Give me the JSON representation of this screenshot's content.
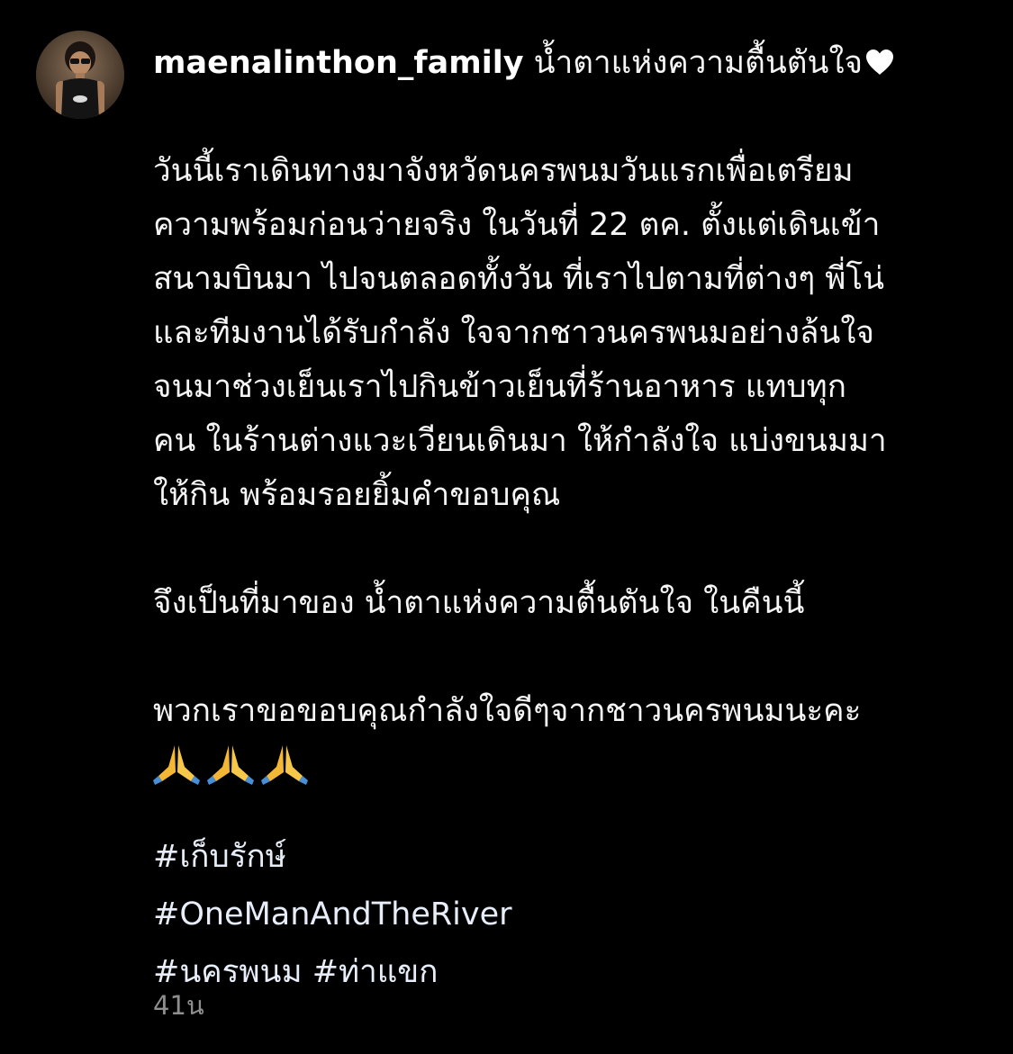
{
  "post": {
    "username": "maenalinthon_family",
    "title_text": "น้ำตาแห่งความตื้นตันใจ",
    "title_emoji": "white-heart-icon",
    "paragraph_1_lines": [
      "วันนี้เราเดินทางมาจังหวัดนครพนมวันแรกเพื่อเตรียม",
      "ความพร้อมก่อนว่ายจริง ในวันที่ 22 ตค. ตั้งแต่เดินเข้า",
      "สนามบินมา ไปจนตลอดทั้งวัน ที่เราไปตามที่ต่างๆ พี่โน่",
      "และทีมงานได้รับกำลัง ใจจากชาวนครพนมอย่างล้นใจ",
      "จนมาช่วงเย็นเราไปกินข้าวเย็นที่ร้านอาหาร แทบทุก",
      "คน ในร้านต่างแวะเวียนเดินมา ให้กำลังใจ แบ่งขนมมา",
      "ให้กิน พร้อมรอยยิ้มคำขอบคุณ"
    ],
    "paragraph_2": "จึงเป็นที่มาของ น้ำตาแห่งความตื้นตันใจ ในคืนนี้",
    "paragraph_3": "พวกเราขอขอบคุณกำลังใจดีๆจากชาวนครพนมนะคะ",
    "emoji_row": [
      "folded-hands-icon",
      "folded-hands-icon",
      "folded-hands-icon"
    ],
    "hashtags": {
      "tag_1": "#เก็บรักษ์",
      "tag_2": "#OneManAndTheRiver",
      "tag_3": "#นครพนม",
      "tag_4": "#ท่าแขก"
    },
    "timestamp": "41น"
  },
  "colors": {
    "background": "#000000",
    "text": "#f5f5f5",
    "hashtag": "#e8eef9",
    "timestamp": "#8e8e8e"
  }
}
